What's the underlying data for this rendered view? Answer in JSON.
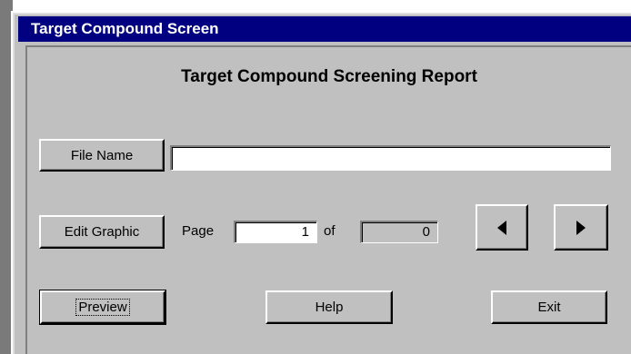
{
  "window": {
    "title": "Target Compound Screen"
  },
  "report": {
    "heading": "Target Compound Screening Report"
  },
  "file": {
    "button_label": "File Name",
    "value": ""
  },
  "graphic": {
    "button_label": "Edit Graphic"
  },
  "paging": {
    "page_label": "Page",
    "current_page": "1",
    "of_label": "of",
    "total_pages": "0",
    "prev_icon": "left-triangle",
    "next_icon": "right-triangle"
  },
  "actions": {
    "preview_label": "Preview",
    "help_label": "Help",
    "exit_label": "Exit"
  },
  "colors": {
    "titlebar": "#000080",
    "face": "#c0c0c0"
  }
}
